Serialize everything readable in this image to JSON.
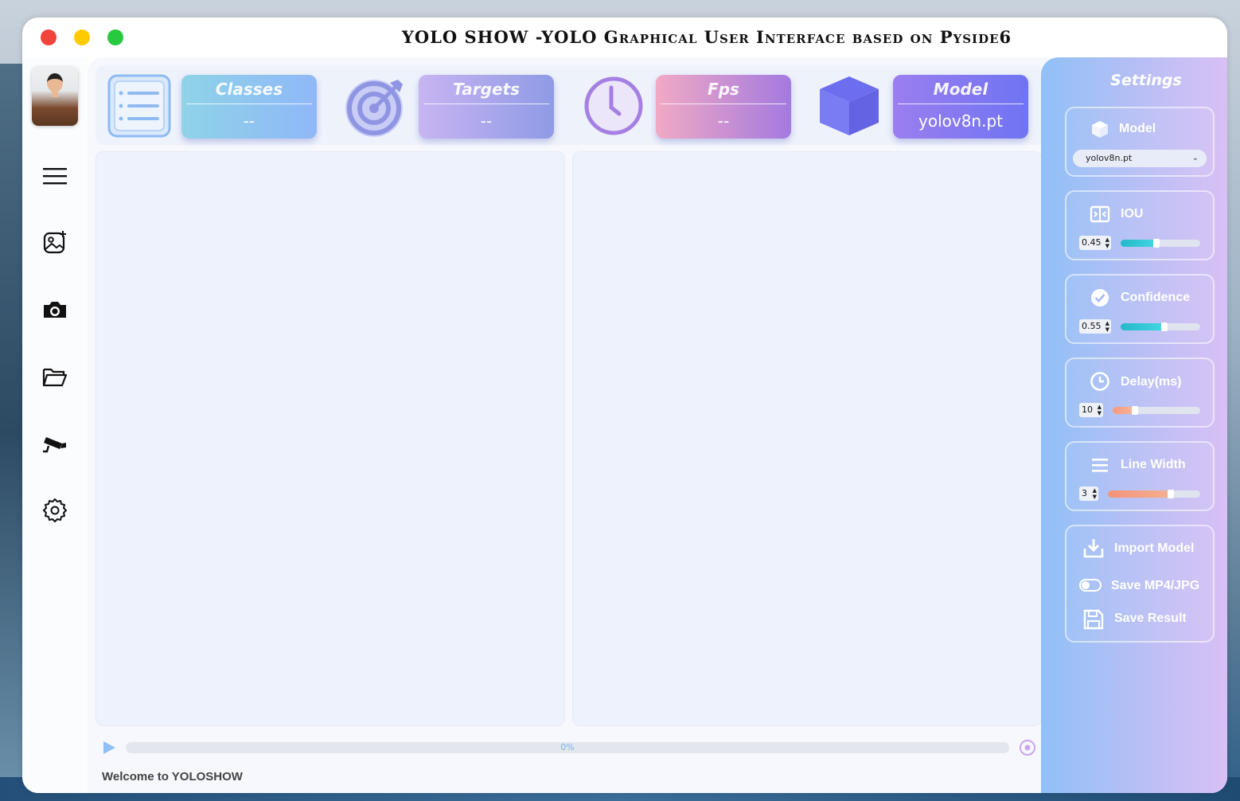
{
  "window": {
    "title": "YOLO SHOW -YOLO Graphical User Interface based on Pyside6"
  },
  "sidebar": {
    "items": [
      {
        "name": "menu"
      },
      {
        "name": "image-add"
      },
      {
        "name": "camera"
      },
      {
        "name": "folder"
      },
      {
        "name": "rtsp-camera"
      },
      {
        "name": "settings"
      }
    ]
  },
  "topbar": {
    "cards": {
      "classes": {
        "title": "Classes",
        "value": "--"
      },
      "targets": {
        "title": "Targets",
        "value": "--"
      },
      "fps": {
        "title": "Fps",
        "value": "--"
      },
      "model": {
        "title": "Model",
        "value": "yolov8n.pt"
      }
    }
  },
  "progress": {
    "value": 0,
    "label": "0%"
  },
  "status": {
    "text": "Welcome to YOLOSHOW"
  },
  "settings": {
    "title": "Settings",
    "model": {
      "label": "Model",
      "selected": "yolov8n.pt"
    },
    "iou": {
      "label": "IOU",
      "value": "0.45",
      "fraction": 0.45
    },
    "confidence": {
      "label": "Confidence",
      "value": "0.55",
      "fraction": 0.55
    },
    "delay": {
      "label": "Delay(ms)",
      "value": "10",
      "fraction": 0.25
    },
    "line_width": {
      "label": "Line Width",
      "value": "3",
      "fraction": 0.68
    },
    "import_model": {
      "label": "Import Model"
    },
    "save_toggle": {
      "label": "Save MP4/JPG",
      "checked": false
    },
    "save_result": {
      "label": "Save Result"
    }
  },
  "colors": {
    "accent_blue": "#90c0f7",
    "accent_purple": "#8f78ee",
    "slider_teal": "#2cc8d8",
    "slider_orange": "#f4917a"
  }
}
